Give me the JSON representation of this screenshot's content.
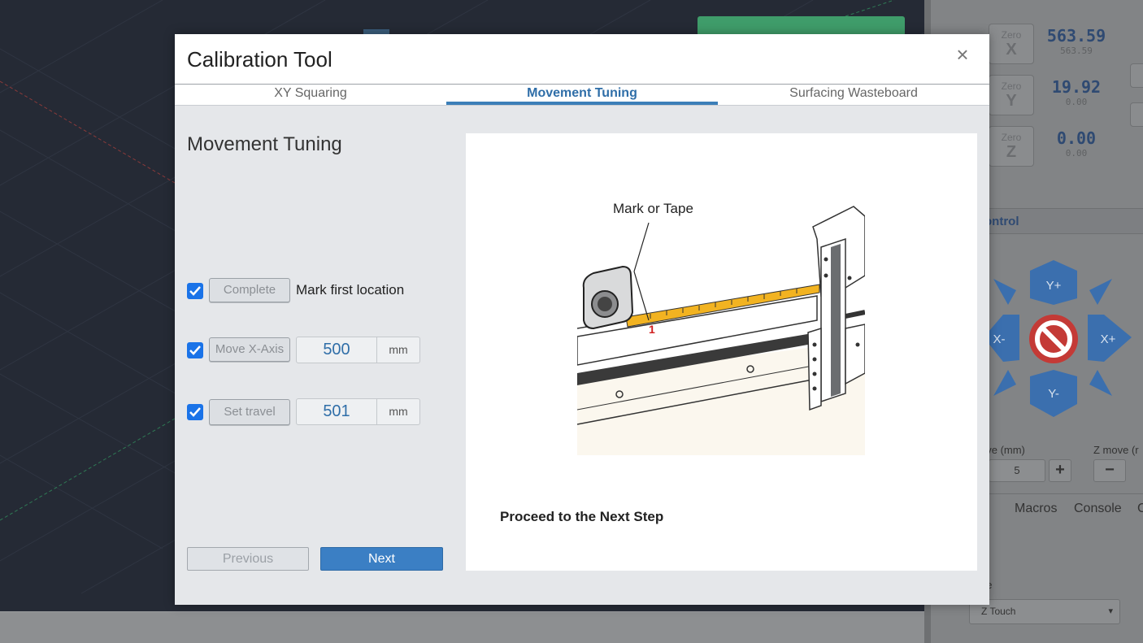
{
  "background": {
    "dro": [
      {
        "zero_label": "Zero",
        "axis": "X",
        "value": "563.59",
        "sub_value": "563.59"
      },
      {
        "zero_label": "Zero",
        "axis": "Y",
        "value": "19.92",
        "sub_value": "0.00"
      },
      {
        "zero_label": "Zero",
        "axis": "Z",
        "value": "0.00",
        "sub_value": "0.00"
      }
    ],
    "panel_title": "ontrol",
    "jog": {
      "yplus": "Y+",
      "yminus": "Y-",
      "xplus": "X+",
      "xminus": "X-"
    },
    "xy_move_label": "ove (mm)",
    "xy_move_value": "5",
    "z_move_label": "Z move (r",
    "plus": "+",
    "minus": "−",
    "tabs": [
      "e",
      "Macros",
      "Console",
      "C"
    ],
    "probe_label": "pe",
    "probe_select": "Z Touch"
  },
  "modal": {
    "title": "Calibration Tool",
    "close": "×",
    "tabs": [
      {
        "label": "XY Squaring",
        "active": false
      },
      {
        "label": "Movement Tuning",
        "active": true
      },
      {
        "label": "Surfacing Wasteboard",
        "active": false
      }
    ],
    "section_title": "Movement Tuning",
    "steps": [
      {
        "checked": true,
        "button": "Complete",
        "label": "Mark first location"
      },
      {
        "checked": true,
        "button": "Move X-Axis",
        "value": "500",
        "unit": "mm"
      },
      {
        "checked": true,
        "button": "Set travel",
        "value": "501",
        "unit": "mm"
      }
    ],
    "previous_label": "Previous",
    "next_label": "Next",
    "illustration": {
      "callout": "Mark or Tape",
      "tape_mark": "1"
    },
    "instruction": "Proceed to the Next Step"
  },
  "colors": {
    "accent": "#3b7fc4",
    "checkbox": "#1a73e8",
    "tape": "#f2b321"
  }
}
